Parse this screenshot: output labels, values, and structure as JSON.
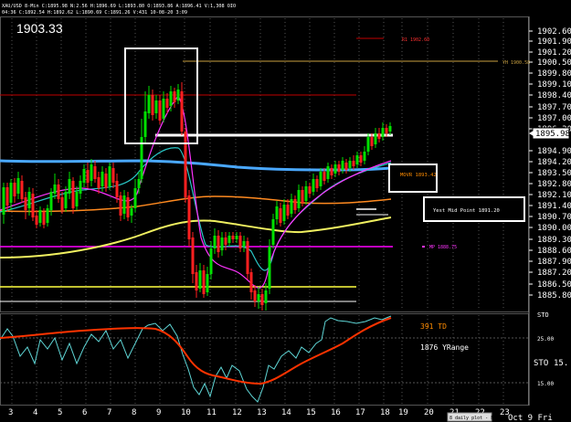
{
  "header": {
    "line1": "XAU/USD 8-Min C:1895.98 N:2.56 H:1896.69 L:1893.80 O:1893.86 A:1896.41 V:1,308 OIO",
    "line2": "04:36 C:1892.54 H:1892.62 L:1890.69 C:1891.26 V:431 10-08-20 3:09",
    "big_price": "1903.33"
  },
  "price_axis": {
    "labels": [
      "1902.60",
      "1901.90",
      "1901.20",
      "1900.50",
      "1899.80",
      "1899.10",
      "1898.40",
      "1897.70",
      "1897.00",
      "1896.30",
      "1894.90",
      "1894.20",
      "1893.50",
      "1892.80",
      "1892.10",
      "1891.40",
      "1890.70",
      "1890.00",
      "1889.30",
      "1888.60",
      "1887.90",
      "1887.20",
      "1886.50",
      "1885.80"
    ],
    "current": "1895.98"
  },
  "indicator_axis": {
    "top_label": "STO",
    "level_25": "25.00",
    "level_15": "15.00",
    "sto_label": "STO",
    "sto_value": "15."
  },
  "time_axis": {
    "labels": [
      "3",
      "4",
      "5",
      "6",
      "7",
      "8",
      "9",
      "10",
      "11",
      "12",
      "13",
      "14",
      "15",
      "16",
      "17",
      "18",
      "19",
      "20",
      "21",
      "22",
      "23"
    ],
    "end_label": "Oct 9 Fri"
  },
  "annotations": {
    "r1": "R1 1902.60",
    "yh": "YH 1900.58",
    "movr": "MOVR 1893.42",
    "ymid": "Yest Mid Point 1891.20",
    "mp": "MP 1888.75"
  },
  "indicator_text": {
    "td": "391 TD",
    "yrange": "1876 YRange"
  },
  "footer": "8 daily plot - Faint",
  "colors": {
    "up_candle": "#00e000",
    "down_candle": "#ff2020",
    "r1_line": "#c00000",
    "yh_line": "#c8a040",
    "blue_ma": "#4aa8ff",
    "cyan_ma": "#29c6c6",
    "magenta_ma": "#ff33ff",
    "orange_ma": "#ff8a20",
    "yellow_ma": "#f0f060",
    "movr_text": "#ff8c00",
    "mp_line": "#ff00ff",
    "osc_red": "#ff3300",
    "osc_cyan": "#5fd6d6"
  }
}
